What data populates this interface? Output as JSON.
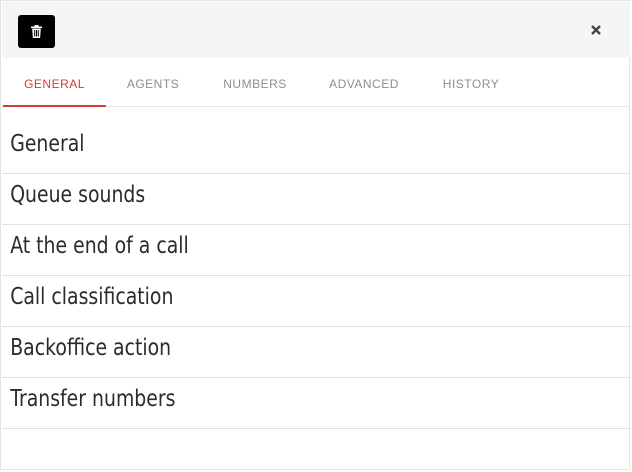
{
  "header": {
    "delete_icon": "trash-icon",
    "close_icon": "close-icon"
  },
  "tabs": [
    {
      "label": "GENERAL",
      "active": true
    },
    {
      "label": "AGENTS",
      "active": false
    },
    {
      "label": "NUMBERS",
      "active": false
    },
    {
      "label": "ADVANCED",
      "active": false
    },
    {
      "label": "HISTORY",
      "active": false
    }
  ],
  "sections": [
    {
      "label": "General"
    },
    {
      "label": "Queue sounds"
    },
    {
      "label": "At the end of a call"
    },
    {
      "label": "Call classification"
    },
    {
      "label": "Backoffice action"
    },
    {
      "label": "Transfer numbers"
    }
  ],
  "colors": {
    "accent": "#d03b34",
    "header_bg": "#f4f5f5",
    "tab_inactive": "#8e8e8e",
    "section_text": "#2b2b2b"
  }
}
